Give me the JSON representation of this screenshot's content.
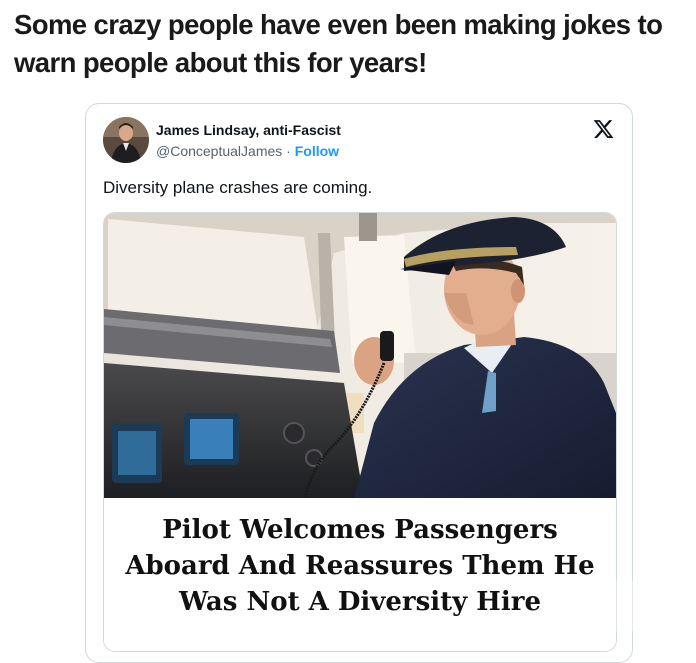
{
  "headline": "Some crazy people have even been making jokes to warn people about this for years!",
  "tweet": {
    "author_name": "James Lindsay, anti-Fascist",
    "handle": "@ConceptualJames",
    "separator": " · ",
    "follow_label": "Follow",
    "text": "Diversity plane crashes are coming.",
    "media_caption": "Pilot Welcomes Passengers Aboard And Reassures Them He Was Not A Diversity Hire",
    "icons": [
      "x-logo-icon",
      "avatar"
    ]
  },
  "colors": {
    "link": "#1d9bf0",
    "text": "#0f1419",
    "muted": "#536471",
    "border": "#cfd9de"
  }
}
